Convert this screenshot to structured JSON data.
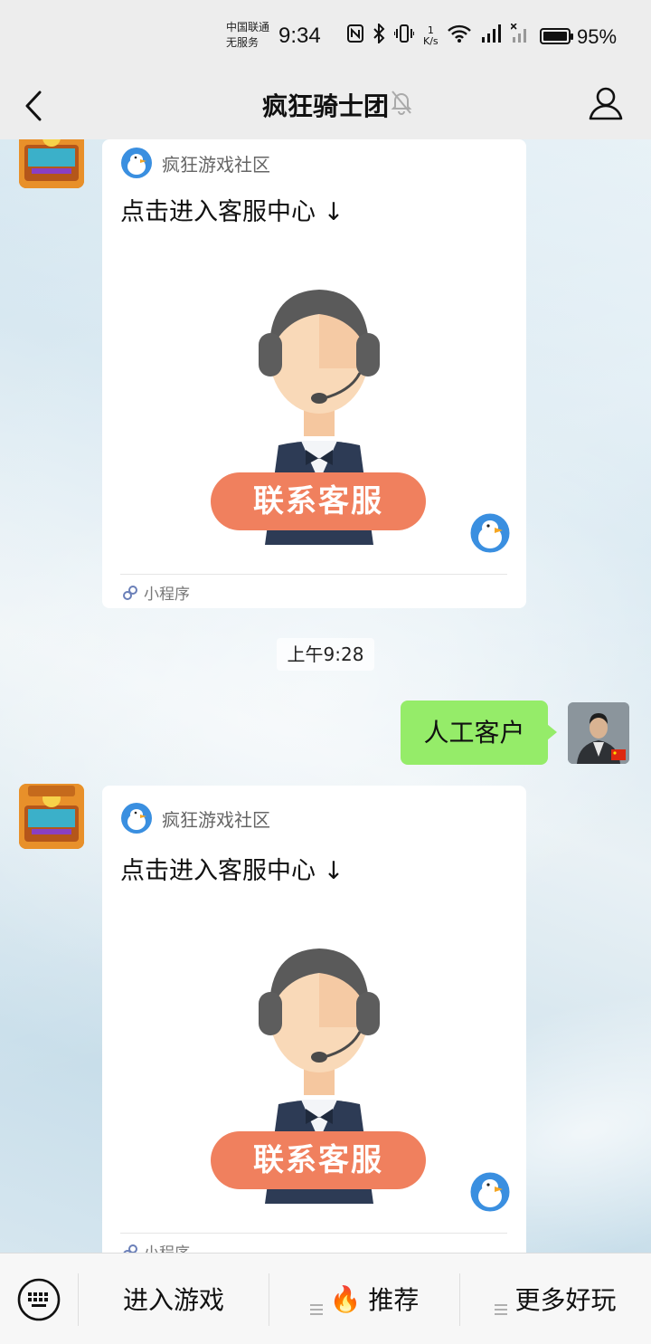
{
  "status_bar": {
    "carrier_line1": "中国联通",
    "carrier_line2": "无服务",
    "time": "9:34",
    "speed_value": "1",
    "speed_unit": "K/s",
    "network": "4G",
    "battery_percent": "95%"
  },
  "header": {
    "title": "疯狂骑士团"
  },
  "messages": [
    {
      "type": "mini_program_card",
      "source": "疯狂游戏社区",
      "title": "点击进入客服中心 ↓",
      "button_text": "联系客服",
      "footer": "小程序"
    },
    {
      "type": "timestamp",
      "text": "上午9:28"
    },
    {
      "type": "text_outgoing",
      "text": "人工客户"
    },
    {
      "type": "mini_program_card",
      "source": "疯狂游戏社区",
      "title": "点击进入客服中心 ↓",
      "button_text": "联系客服",
      "footer": "小程序"
    }
  ],
  "menu": {
    "items": [
      {
        "label": "进入游戏"
      },
      {
        "label": "推荐",
        "emoji": "🔥"
      },
      {
        "label": "更多好玩"
      }
    ]
  },
  "colors": {
    "outgoing_bubble": "#95ec69",
    "contact_button": "#f0805e",
    "header_bg": "#ededed"
  }
}
